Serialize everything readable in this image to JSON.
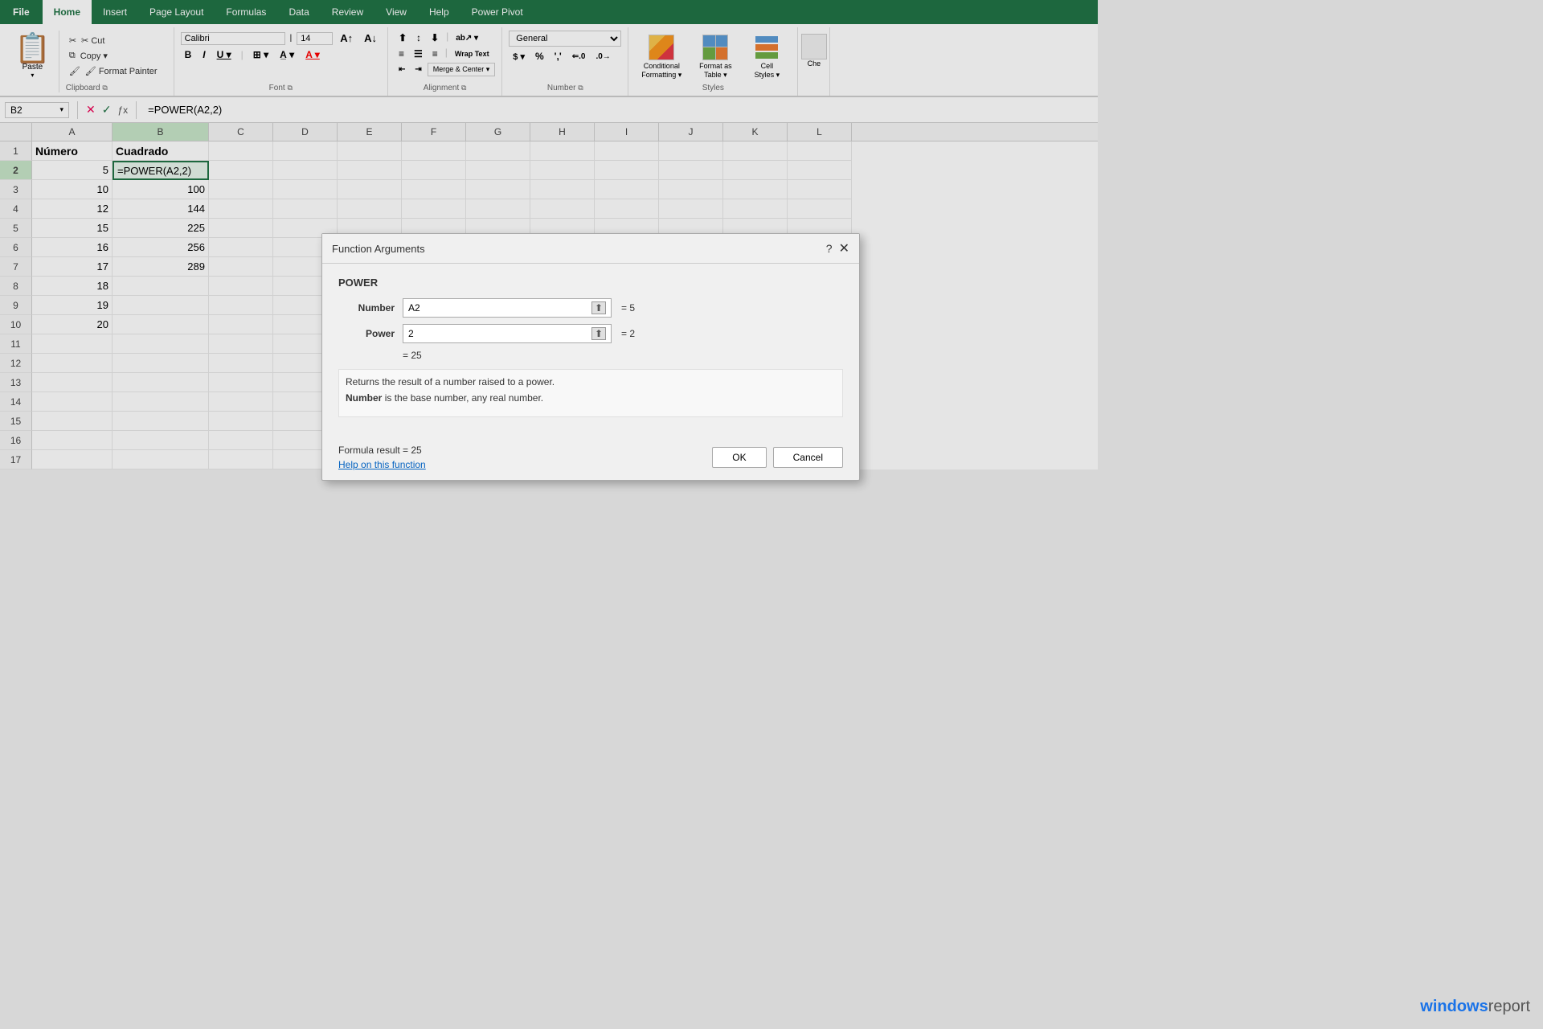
{
  "ribbon": {
    "tabs": [
      "File",
      "Home",
      "Insert",
      "Page Layout",
      "Formulas",
      "Data",
      "Review",
      "View",
      "Help",
      "Power Pivot"
    ],
    "active_tab": "Home",
    "file_tab": "File",
    "groups": {
      "clipboard": {
        "label": "Clipboard",
        "paste": "Paste",
        "cut": "✂ Cut",
        "copy": "📋 Copy",
        "format_painter": "🖌 Format Painter"
      },
      "font": {
        "label": "Font",
        "font_name": "Calibri",
        "font_size": "14",
        "bold": "B",
        "italic": "I",
        "underline": "U"
      },
      "alignment": {
        "label": "Alignment",
        "wrap_text": "Wrap Text",
        "merge_center": "Merge & Center"
      },
      "number": {
        "label": "Number",
        "format": "General"
      },
      "styles": {
        "label": "Styles",
        "conditional_formatting": "Conditional Formatting",
        "format_as_table": "Format as Table",
        "cell_styles": "Cell Styles"
      }
    }
  },
  "formula_bar": {
    "cell_ref": "B2",
    "formula": "=POWER(A2,2)"
  },
  "spreadsheet": {
    "columns": [
      "A",
      "B",
      "C",
      "D",
      "E",
      "F",
      "G",
      "H",
      "I",
      "J",
      "K",
      "L"
    ],
    "rows": [
      {
        "num": 1,
        "a": "Número",
        "b": "Cuadrado",
        "c": "",
        "d": "",
        "e": "",
        "f": "",
        "g": "",
        "h": "",
        "i": "",
        "j": "",
        "k": "",
        "l": ""
      },
      {
        "num": 2,
        "a": "5",
        "b": "=POWER(A2,2)",
        "c": "",
        "d": "",
        "e": "",
        "f": "",
        "g": "",
        "h": "",
        "i": "",
        "j": "",
        "k": "",
        "l": ""
      },
      {
        "num": 3,
        "a": "10",
        "b": "100",
        "c": "",
        "d": "",
        "e": "",
        "f": "",
        "g": "",
        "h": "",
        "i": "",
        "j": "",
        "k": "",
        "l": ""
      },
      {
        "num": 4,
        "a": "12",
        "b": "144",
        "c": "",
        "d": "",
        "e": "",
        "f": "",
        "g": "",
        "h": "",
        "i": "",
        "j": "",
        "k": "",
        "l": ""
      },
      {
        "num": 5,
        "a": "15",
        "b": "225",
        "c": "",
        "d": "",
        "e": "",
        "f": "",
        "g": "",
        "h": "",
        "i": "",
        "j": "",
        "k": "",
        "l": ""
      },
      {
        "num": 6,
        "a": "16",
        "b": "256",
        "c": "",
        "d": "",
        "e": "",
        "f": "",
        "g": "",
        "h": "",
        "i": "",
        "j": "",
        "k": "",
        "l": ""
      },
      {
        "num": 7,
        "a": "17",
        "b": "289",
        "c": "",
        "d": "",
        "e": "",
        "f": "",
        "g": "",
        "h": "",
        "i": "",
        "j": "",
        "k": "",
        "l": ""
      },
      {
        "num": 8,
        "a": "18",
        "b": "",
        "c": "",
        "d": "",
        "e": "",
        "f": "",
        "g": "",
        "h": "",
        "i": "",
        "j": "",
        "k": "",
        "l": ""
      },
      {
        "num": 9,
        "a": "19",
        "b": "",
        "c": "",
        "d": "",
        "e": "",
        "f": "",
        "g": "",
        "h": "",
        "i": "",
        "j": "",
        "k": "",
        "l": ""
      },
      {
        "num": 10,
        "a": "20",
        "b": "",
        "c": "",
        "d": "",
        "e": "",
        "f": "",
        "g": "",
        "h": "",
        "i": "",
        "j": "",
        "k": "",
        "l": ""
      },
      {
        "num": 11,
        "a": "",
        "b": "",
        "c": "",
        "d": "",
        "e": "",
        "f": "",
        "g": "",
        "h": "",
        "i": "",
        "j": "",
        "k": "",
        "l": ""
      },
      {
        "num": 12,
        "a": "",
        "b": "",
        "c": "",
        "d": "",
        "e": "",
        "f": "",
        "g": "",
        "h": "",
        "i": "",
        "j": "",
        "k": "",
        "l": ""
      },
      {
        "num": 13,
        "a": "",
        "b": "",
        "c": "",
        "d": "",
        "e": "",
        "f": "",
        "g": "",
        "h": "",
        "i": "",
        "j": "",
        "k": "",
        "l": ""
      },
      {
        "num": 14,
        "a": "",
        "b": "",
        "c": "",
        "d": "",
        "e": "",
        "f": "",
        "g": "",
        "h": "",
        "i": "",
        "j": "",
        "k": "",
        "l": ""
      },
      {
        "num": 15,
        "a": "",
        "b": "",
        "c": "",
        "d": "",
        "e": "",
        "f": "",
        "g": "",
        "h": "",
        "i": "",
        "j": "",
        "k": "",
        "l": ""
      },
      {
        "num": 16,
        "a": "",
        "b": "",
        "c": "",
        "d": "",
        "e": "",
        "f": "",
        "g": "",
        "h": "",
        "i": "",
        "j": "",
        "k": "",
        "l": ""
      },
      {
        "num": 17,
        "a": "",
        "b": "",
        "c": "",
        "d": "",
        "e": "",
        "f": "",
        "g": "",
        "h": "",
        "i": "",
        "j": "",
        "k": "",
        "l": ""
      }
    ]
  },
  "dialog": {
    "title": "Function Arguments",
    "func_name": "POWER",
    "number_label": "Number",
    "number_value": "A2",
    "number_result": "= 5",
    "power_label": "Power",
    "power_value": "2",
    "power_result": "= 2",
    "eq_result": "= 25",
    "description": "Returns the result of a number raised to a power.",
    "number_desc_bold": "Number",
    "number_desc_text": "is the base number, any real number.",
    "formula_result_label": "Formula result =",
    "formula_result_value": "25",
    "help_link": "Help on this function",
    "ok_label": "OK",
    "cancel_label": "Cancel"
  },
  "watermark": {
    "win": "windows",
    "report": "report"
  }
}
